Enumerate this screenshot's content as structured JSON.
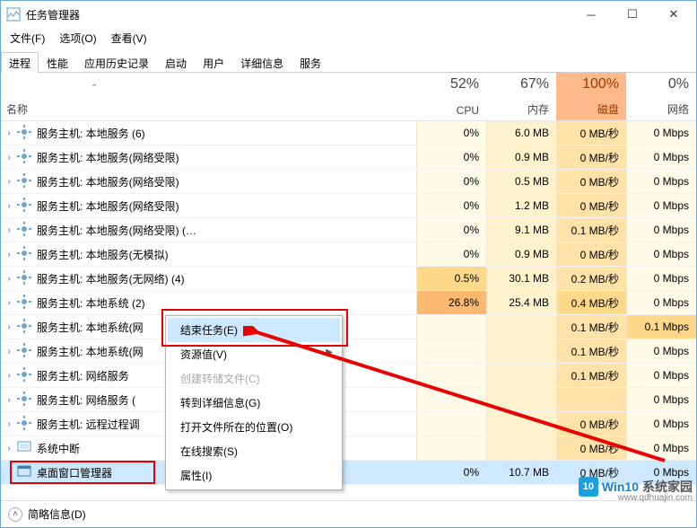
{
  "window": {
    "title": "任务管理器"
  },
  "menus": {
    "file": "文件(F)",
    "options": "选项(O)",
    "view": "查看(V)"
  },
  "tabs": {
    "processes": "进程",
    "performance": "性能",
    "history": "应用历史记录",
    "startup": "启动",
    "users": "用户",
    "details": "详细信息",
    "services": "服务"
  },
  "columns": {
    "name": "名称",
    "cpu": {
      "pct": "52%",
      "label": "CPU"
    },
    "mem": {
      "pct": "67%",
      "label": "内存"
    },
    "disk": {
      "pct": "100%",
      "label": "磁盘"
    },
    "net": {
      "pct": "0%",
      "label": "网络"
    }
  },
  "rows": [
    {
      "name": "服务主机: 本地服务 (6)",
      "cpu": "0%",
      "mem": "6.0 MB",
      "disk": "0 MB/秒",
      "net": "0 Mbps"
    },
    {
      "name": "服务主机: 本地服务(网络受限)",
      "cpu": "0%",
      "mem": "0.9 MB",
      "disk": "0 MB/秒",
      "net": "0 Mbps"
    },
    {
      "name": "服务主机: 本地服务(网络受限)",
      "cpu": "0%",
      "mem": "0.5 MB",
      "disk": "0 MB/秒",
      "net": "0 Mbps"
    },
    {
      "name": "服务主机: 本地服务(网络受限)",
      "cpu": "0%",
      "mem": "1.2 MB",
      "disk": "0 MB/秒",
      "net": "0 Mbps"
    },
    {
      "name": "服务主机: 本地服务(网络受限) (…",
      "cpu": "0%",
      "mem": "9.1 MB",
      "disk": "0.1 MB/秒",
      "net": "0 Mbps"
    },
    {
      "name": "服务主机: 本地服务(无模拟)",
      "cpu": "0%",
      "mem": "0.9 MB",
      "disk": "0 MB/秒",
      "net": "0 Mbps"
    },
    {
      "name": "服务主机: 本地服务(无网络) (4)",
      "cpu": "0.5%",
      "mem": "30.1 MB",
      "disk": "0.2 MB/秒",
      "net": "0 Mbps"
    },
    {
      "name": "服务主机: 本地系统 (2)",
      "cpu": "26.8%",
      "mem": "25.4 MB",
      "disk": "0.4 MB/秒",
      "net": "0 Mbps"
    },
    {
      "name": "服务主机: 本地系统(网",
      "cpu": "",
      "mem": "",
      "disk": "0.1 MB/秒",
      "net": "0.1 Mbps"
    },
    {
      "name": "服务主机: 本地系统(网",
      "cpu": "",
      "mem": "",
      "disk": "0.1 MB/秒",
      "net": "0 Mbps"
    },
    {
      "name": "服务主机: 网络服务",
      "cpu": "",
      "mem": "",
      "disk": "0.1 MB/秒",
      "net": "0 Mbps"
    },
    {
      "name": "服务主机: 网络服务 (",
      "cpu": "",
      "mem": "",
      "disk": "",
      "net": "0 Mbps"
    },
    {
      "name": "服务主机: 远程过程调",
      "cpu": "",
      "mem": "",
      "disk": "0 MB/秒",
      "net": "0 Mbps"
    },
    {
      "name": "系统中断",
      "cpu": "",
      "mem": "",
      "disk": "0 MB/秒",
      "net": "0 Mbps",
      "icon": "sys"
    },
    {
      "name": "桌面窗口管理器",
      "cpu": "0%",
      "mem": "10.7 MB",
      "disk": "0 MB/秒",
      "net": "0 Mbps",
      "selected": true,
      "icon": "dwm",
      "noarrow": true
    }
  ],
  "context_menu": {
    "end_task": "结束任务(E)",
    "resource_values": "资源值(V)",
    "create_dump": "创建转储文件(C)",
    "go_to_details": "转到详细信息(G)",
    "open_location": "打开文件所在的位置(O)",
    "search_online": "在线搜索(S)",
    "properties": "属性(I)"
  },
  "statusbar": {
    "brief": "简略信息(D)"
  },
  "watermark": {
    "brand1": "Win10",
    "brand2": "系统家园",
    "badge": "10",
    "url": "www.qdhuajin.com"
  }
}
